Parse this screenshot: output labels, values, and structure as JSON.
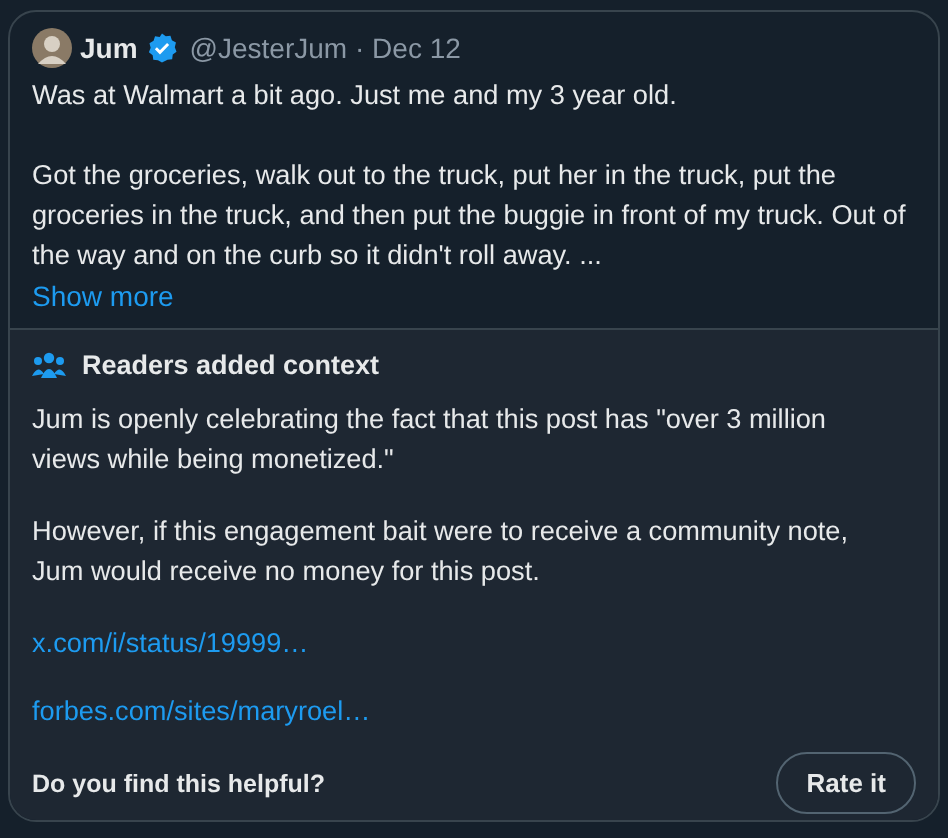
{
  "post": {
    "name": "Jum",
    "verified": true,
    "handle": "@JesterJum",
    "separator": "·",
    "date": "Dec 12",
    "paragraphs": [
      "Was at Walmart a bit ago. Just me and my 3 year old.",
      "Got the groceries, walk out to the truck, put her in the truck, put the groceries in the truck, and then put the buggie in front of my truck. Out of the way and on the curb so it didn't roll away. ..."
    ],
    "show_more": "Show more"
  },
  "note": {
    "heading": "Readers added context",
    "paragraphs": [
      "Jum is openly celebrating the fact that this post has \"over 3 million views while being monetized.\"",
      "However, if this engagement bait were to receive a community note, Jum would receive no money for this post."
    ],
    "links": [
      "x.com/i/status/19999…",
      "forbes.com/sites/maryroel…"
    ],
    "question": "Do you find this helpful?",
    "button": "Rate it"
  }
}
